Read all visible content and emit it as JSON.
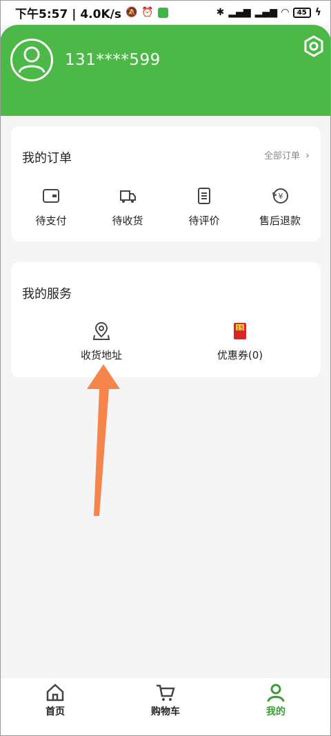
{
  "status_bar": {
    "time_speed": "下午5:57 | 4.0K/s",
    "battery": "45"
  },
  "profile": {
    "phone": "131****599"
  },
  "orders": {
    "title": "我的订单",
    "all_link": "全部订单",
    "items": [
      {
        "label": "待支付",
        "icon": "wallet-icon"
      },
      {
        "label": "待收货",
        "icon": "delivery-truck-icon"
      },
      {
        "label": "待评价",
        "icon": "document-icon"
      },
      {
        "label": "售后退款",
        "icon": "refund-yen-icon"
      }
    ]
  },
  "services": {
    "title": "我的服务",
    "items": [
      {
        "label": "收货地址",
        "icon": "map-pin-icon"
      },
      {
        "label": "优惠券(0)",
        "icon": "coupon-red-envelope-icon"
      }
    ]
  },
  "bottom_nav": {
    "items": [
      {
        "label": "首页",
        "icon": "home-icon"
      },
      {
        "label": "购物车",
        "icon": "cart-icon"
      },
      {
        "label": "我的",
        "icon": "person-icon",
        "active": true
      }
    ]
  },
  "colors": {
    "brand_green": "#4cb848",
    "active_green": "#3a9a36",
    "annotation_arrow": "#f5854b"
  }
}
